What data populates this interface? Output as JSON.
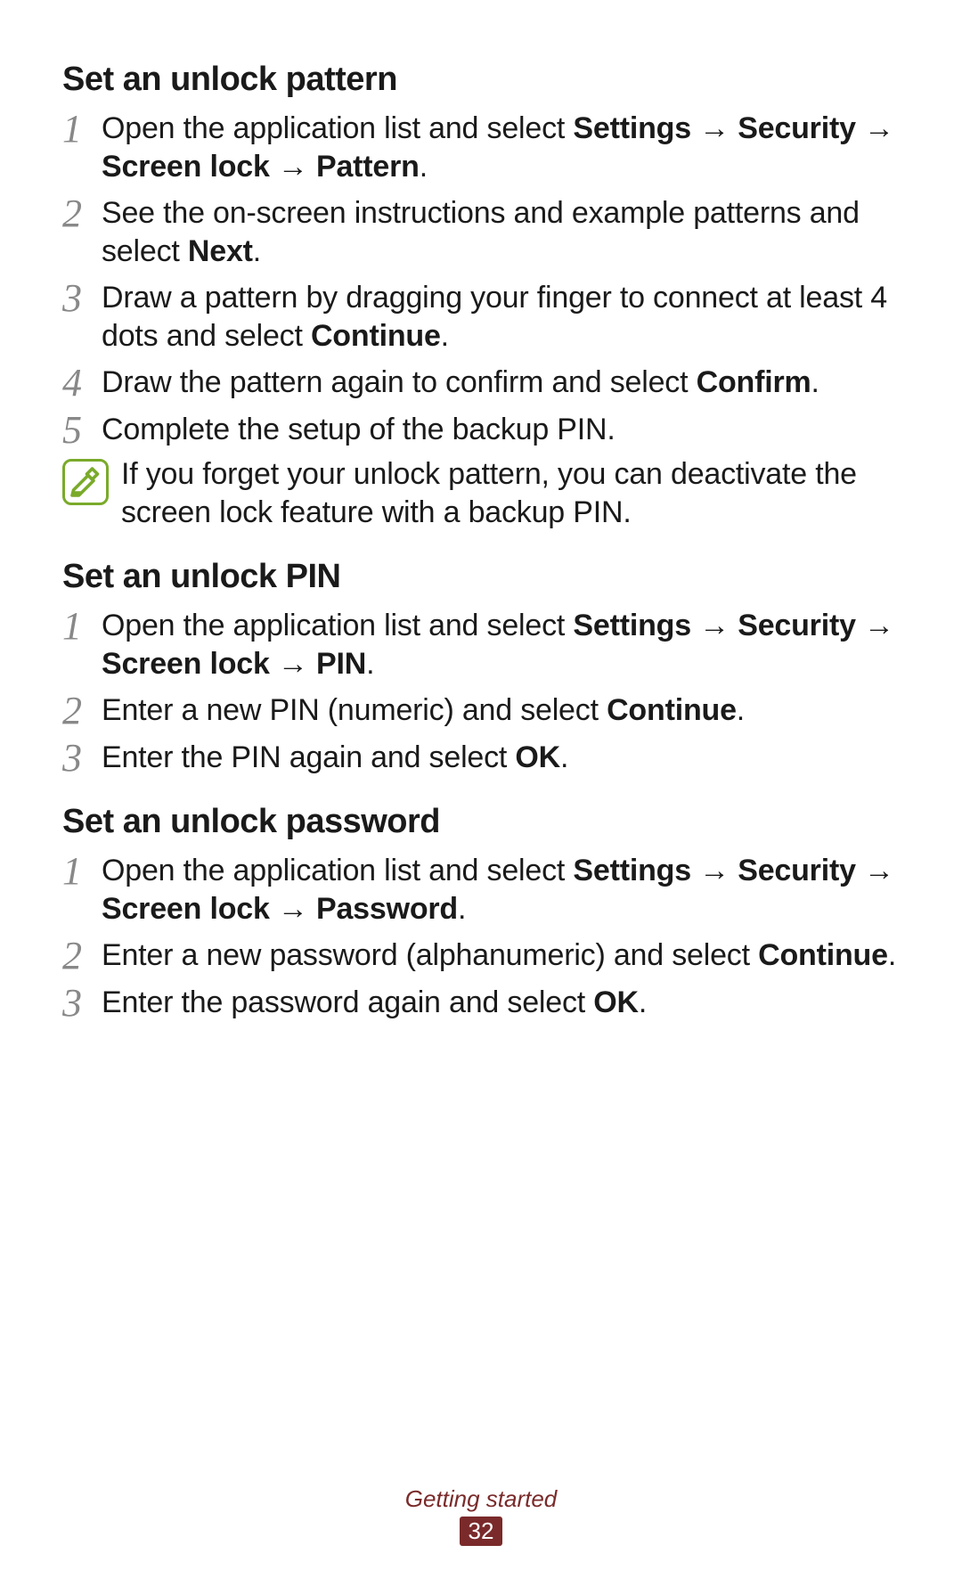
{
  "sections": [
    {
      "heading": "Set an unlock pattern",
      "steps": [
        {
          "num": "1",
          "parts": [
            "Open the application list and select ",
            {
              "b": "Settings"
            },
            " → ",
            {
              "b": "Security"
            },
            " → ",
            {
              "b": "Screen lock"
            },
            " → ",
            {
              "b": "Pattern"
            },
            "."
          ]
        },
        {
          "num": "2",
          "parts": [
            "See the on-screen instructions and example patterns and select ",
            {
              "b": "Next"
            },
            "."
          ]
        },
        {
          "num": "3",
          "parts": [
            "Draw a pattern by dragging your finger to connect at least 4 dots and select ",
            {
              "b": "Continue"
            },
            "."
          ]
        },
        {
          "num": "4",
          "parts": [
            "Draw the pattern again to confirm and select ",
            {
              "b": "Confirm"
            },
            "."
          ]
        },
        {
          "num": "5",
          "parts": [
            "Complete the setup of the backup PIN."
          ]
        }
      ],
      "note": "If you forget your unlock pattern, you can deactivate the screen lock feature with a backup PIN."
    },
    {
      "heading": "Set an unlock PIN",
      "steps": [
        {
          "num": "1",
          "parts": [
            "Open the application list and select ",
            {
              "b": "Settings"
            },
            " → ",
            {
              "b": "Security"
            },
            " → ",
            {
              "b": "Screen lock"
            },
            " → ",
            {
              "b": "PIN"
            },
            "."
          ]
        },
        {
          "num": "2",
          "parts": [
            "Enter a new PIN (numeric) and select ",
            {
              "b": "Continue"
            },
            "."
          ]
        },
        {
          "num": "3",
          "parts": [
            "Enter the PIN again and select ",
            {
              "b": "OK"
            },
            "."
          ]
        }
      ]
    },
    {
      "heading": "Set an unlock password",
      "steps": [
        {
          "num": "1",
          "parts": [
            "Open the application list and select ",
            {
              "b": "Settings"
            },
            " → ",
            {
              "b": "Security"
            },
            " → ",
            {
              "b": "Screen lock"
            },
            " → ",
            {
              "b": "Password"
            },
            "."
          ]
        },
        {
          "num": "2",
          "parts": [
            "Enter a new password (alphanumeric) and select ",
            {
              "b": "Continue"
            },
            "."
          ]
        },
        {
          "num": "3",
          "parts": [
            "Enter the password again and select ",
            {
              "b": "OK"
            },
            "."
          ]
        }
      ]
    }
  ],
  "footer": {
    "chapter": "Getting started",
    "page": "32"
  }
}
